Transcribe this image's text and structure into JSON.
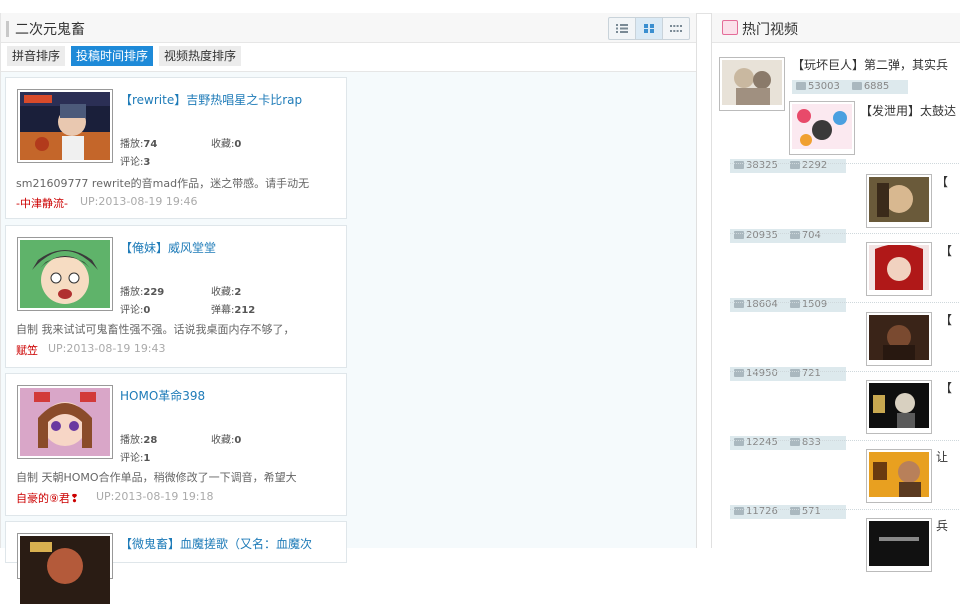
{
  "left": {
    "title": "二次元鬼畜",
    "view_icons": [
      "list-view-icon",
      "grid-view-icon",
      "compact-view-icon"
    ],
    "sort_tabs": [
      "拼音排序",
      "投稿时间排序",
      "视频热度排序"
    ],
    "active_sort": 1,
    "labels": {
      "play": "播放:",
      "fav": "收藏:",
      "comment": "评论:",
      "danmaku": "弹幕:"
    },
    "videos": [
      {
        "title": "【rewrite】吉野热唱星之卡比rap",
        "play": "74",
        "fav": "0",
        "comment": "3",
        "danmaku": "",
        "desc": "sm21609777 rewrite的音mad作品，迷之带感。请手动无",
        "uploader": "-中津静流-",
        "uptime": "UP:2013-08-19 19:46"
      },
      {
        "title": "【俺妹】威风堂堂",
        "play": "229",
        "fav": "2",
        "comment": "0",
        "danmaku": "212",
        "desc": "自制 我来试试可鬼畜性强不强。话说我桌面内存不够了，",
        "uploader": "赋笠",
        "uptime": "UP:2013-08-19 19:43"
      },
      {
        "title": "HOMO革命398",
        "play": "28",
        "fav": "0",
        "comment": "1",
        "danmaku": "",
        "desc": "自制 天朝HOMO合作单品，稍微修改了一下调音，希望大",
        "uploader": "自豪的⑨君❢",
        "uptime": "UP:2013-08-19 19:18"
      },
      {
        "title": "【微鬼畜】血魔搓歌（又名：血魔次",
        "play": "",
        "fav": "",
        "comment": "",
        "danmaku": "",
        "desc": "",
        "uploader": "",
        "uptime": ""
      }
    ]
  },
  "right": {
    "title": "热门视频",
    "items": [
      {
        "title": "【玩坏巨人】第二弹，其实兵",
        "play": "53003",
        "comment": "6885"
      },
      {
        "title": "【发泄用】太鼓达",
        "play": "38325",
        "comment": "2292"
      },
      {
        "title": "【",
        "play": "20935",
        "comment": "704"
      },
      {
        "title": "【",
        "play": "18604",
        "comment": "1509"
      },
      {
        "title": "【",
        "play": "14950",
        "comment": "721"
      },
      {
        "title": "【",
        "play": "12245",
        "comment": "833"
      },
      {
        "title": "让",
        "play": "11726",
        "comment": "571"
      },
      {
        "title": "兵",
        "play": "",
        "comment": ""
      }
    ]
  },
  "colors": {
    "accent": "#1e8ad8",
    "link": "#1e7bb8",
    "uploader": "#cc0000"
  }
}
